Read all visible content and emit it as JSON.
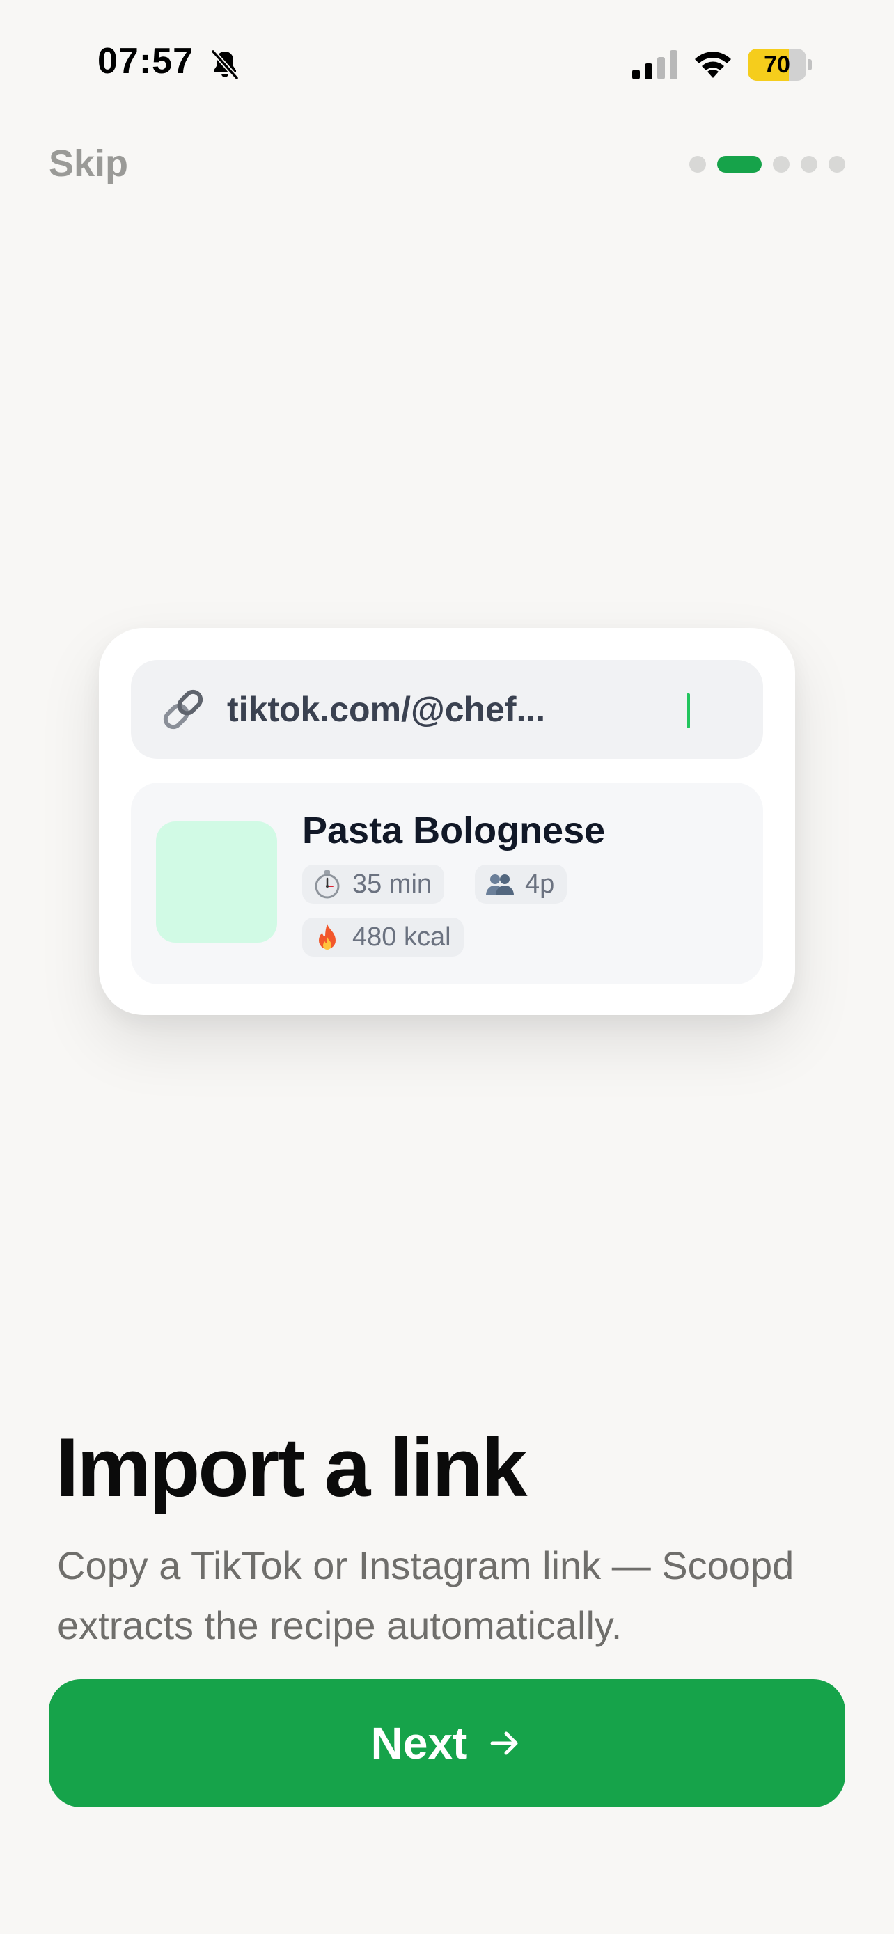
{
  "status_bar": {
    "time": "07:57",
    "battery_level": "70",
    "battery_fraction": 0.7,
    "icons": [
      "bell-slash-icon",
      "cellular-signal-icon",
      "wifi-icon",
      "battery-icon"
    ]
  },
  "nav": {
    "skip_label": "Skip",
    "page_indicator": {
      "total": 5,
      "current": 2
    }
  },
  "preview": {
    "url_icon": "link-icon",
    "url_text": "tiktok.com/@chef...",
    "recipe": {
      "title": "Pasta Bolognese",
      "time": "35 min",
      "time_icon": "stopwatch-icon",
      "servings": "4p",
      "servings_icon": "people-icon",
      "calories": "480 kcal",
      "calories_icon": "fire-icon"
    }
  },
  "content": {
    "headline": "Import a link",
    "subtitle": "Copy a TikTok or Instagram link — Scoopd extracts the recipe automatically."
  },
  "footer": {
    "next_label": "Next",
    "next_icon": "arrow-right-icon"
  },
  "colors": {
    "accent": "#16a34a",
    "background": "#f8f7f5",
    "thumbnail": "#d1fae5",
    "battery": "#f5cd1c"
  }
}
